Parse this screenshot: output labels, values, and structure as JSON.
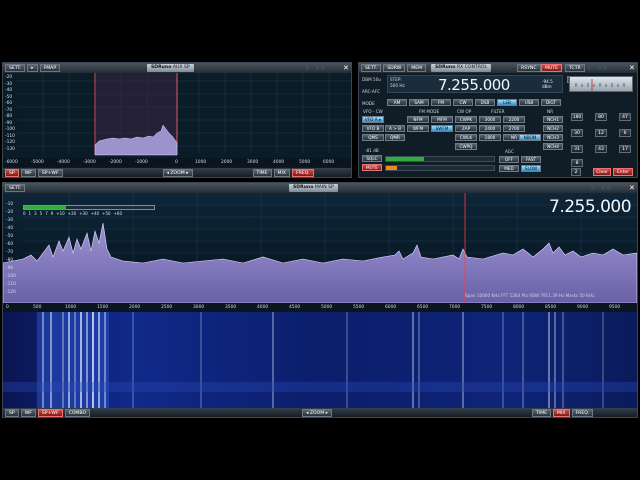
{
  "aux_window": {
    "buttons": [
      "SETT.",
      "▸",
      "FMAP"
    ],
    "title_brand": "SDRuno",
    "title_name": "AUX SP",
    "lcd": "0-00",
    "close": "✕",
    "y_ticks": [
      "-20",
      "-30",
      "-40",
      "-50",
      "-60",
      "-70",
      "-80",
      "-90",
      "-100",
      "-110",
      "-120",
      "-130"
    ],
    "x_ticks": [
      "-6000",
      "-5000",
      "-4000",
      "-3000",
      "-2000",
      "-1000",
      "0",
      "1000",
      "2000",
      "3000",
      "4000",
      "5000",
      "6000"
    ],
    "bottom_left": [
      "SP",
      "WF",
      "SP+WF"
    ],
    "zoom_label": "ZOOM",
    "bottom_right": [
      "TIME",
      "MIX",
      "FREQ."
    ]
  },
  "rx_window": {
    "buttons": [
      "SETT.",
      "SDRW",
      "MEM"
    ],
    "title_brand": "SDRuno",
    "title_name": "RX CONTROL",
    "right_buttons": [
      "RSYNC",
      "MUTE",
      "TCTR"
    ],
    "lcd": "0-00",
    "close": "✕",
    "step_label": "STEP:",
    "step_value": "500 Hz",
    "dbm_label": "DBM 50u",
    "afc_label": "ARC-AFC",
    "frequency": "7.255.000",
    "signal_value": "-94.5 dBm",
    "nbw_label": "NBW",
    "mode_label": "MODE",
    "modes": [
      "AM",
      "SAM",
      "FM",
      "CW",
      "DSB",
      "LSB",
      "USB",
      "DIGT"
    ],
    "vfo_label": "VFO - CW",
    "fm_mode_label": "FM MODE",
    "cw_op_label": "CW OP",
    "filter_label": "FILTER",
    "nr_label": "NR",
    "vfo_a": "VFO A ▸",
    "vfo_b": "VFO B",
    "row1": [
      "NFM",
      "MFM",
      "CWPK",
      "3000",
      "2200",
      "NCH1"
    ],
    "row2": [
      "A > B",
      "WFM",
      "ZAP",
      "2400",
      "2700",
      "NCH2"
    ],
    "row3": [
      "QMS",
      "SWFM",
      "CWLK",
      "1800",
      "NR",
      "NCH3"
    ],
    "row4": [
      "QMR",
      "CWPQ",
      "NBOM",
      "NCH4"
    ],
    "level_readout": "-81 dB",
    "sqlc": "SQLC",
    "mute_btn": "MUTE",
    "agc_label": "AGC",
    "agc_modes": [
      "OFF",
      "FAST",
      "MED",
      "SLOW"
    ],
    "keypad": [
      "180",
      "80",
      "47",
      "30",
      "12",
      "6",
      "31",
      "43",
      "17",
      "8",
      "2",
      "Clear",
      "Enter"
    ],
    "signal_fill": 0.3,
    "volume_fill": 0.1
  },
  "main_window": {
    "buttons": [
      "SETT."
    ],
    "title_brand": "SDRuno",
    "title_name": "MAIN SP",
    "lcd": "0-00",
    "close": "✕",
    "frequency": "7.255.000",
    "s_scale": [
      "0",
      "1",
      "3",
      "5",
      "7",
      "9",
      "+10",
      "+20",
      "+30",
      "+40",
      "+50",
      "+60"
    ],
    "y_ticks": [
      "-10",
      "-20",
      "-30",
      "-40",
      "-50",
      "-60",
      "-70",
      "-80",
      "-90",
      "-100",
      "-110",
      "-120"
    ],
    "x_ticks": [
      "0",
      "500",
      "1000",
      "1500",
      "2000",
      "2500",
      "3000",
      "3500",
      "4000",
      "4500",
      "5000",
      "5500",
      "6000",
      "6500",
      "7000",
      "7500",
      "8000",
      "8500",
      "9000",
      "9500"
    ],
    "info_text": "Span 10000 KHz  FFT 1264 Pts  RBW 7911.39 Hz  Marks 50 KHz",
    "bottom_left": [
      "SP",
      "WF",
      "SP+WF",
      "COMBO"
    ],
    "zoom_label": "ZOOM",
    "bottom_right": [
      "TIME",
      "MIX",
      "FREQ."
    ]
  },
  "colors": {
    "spectrum_fill": "#7f74b8",
    "waterfall_bg": "#0a1e6a",
    "marker_red": "#ff3b3b",
    "signal_green": "#2fae3a",
    "volume_orange": "#f08a20"
  }
}
